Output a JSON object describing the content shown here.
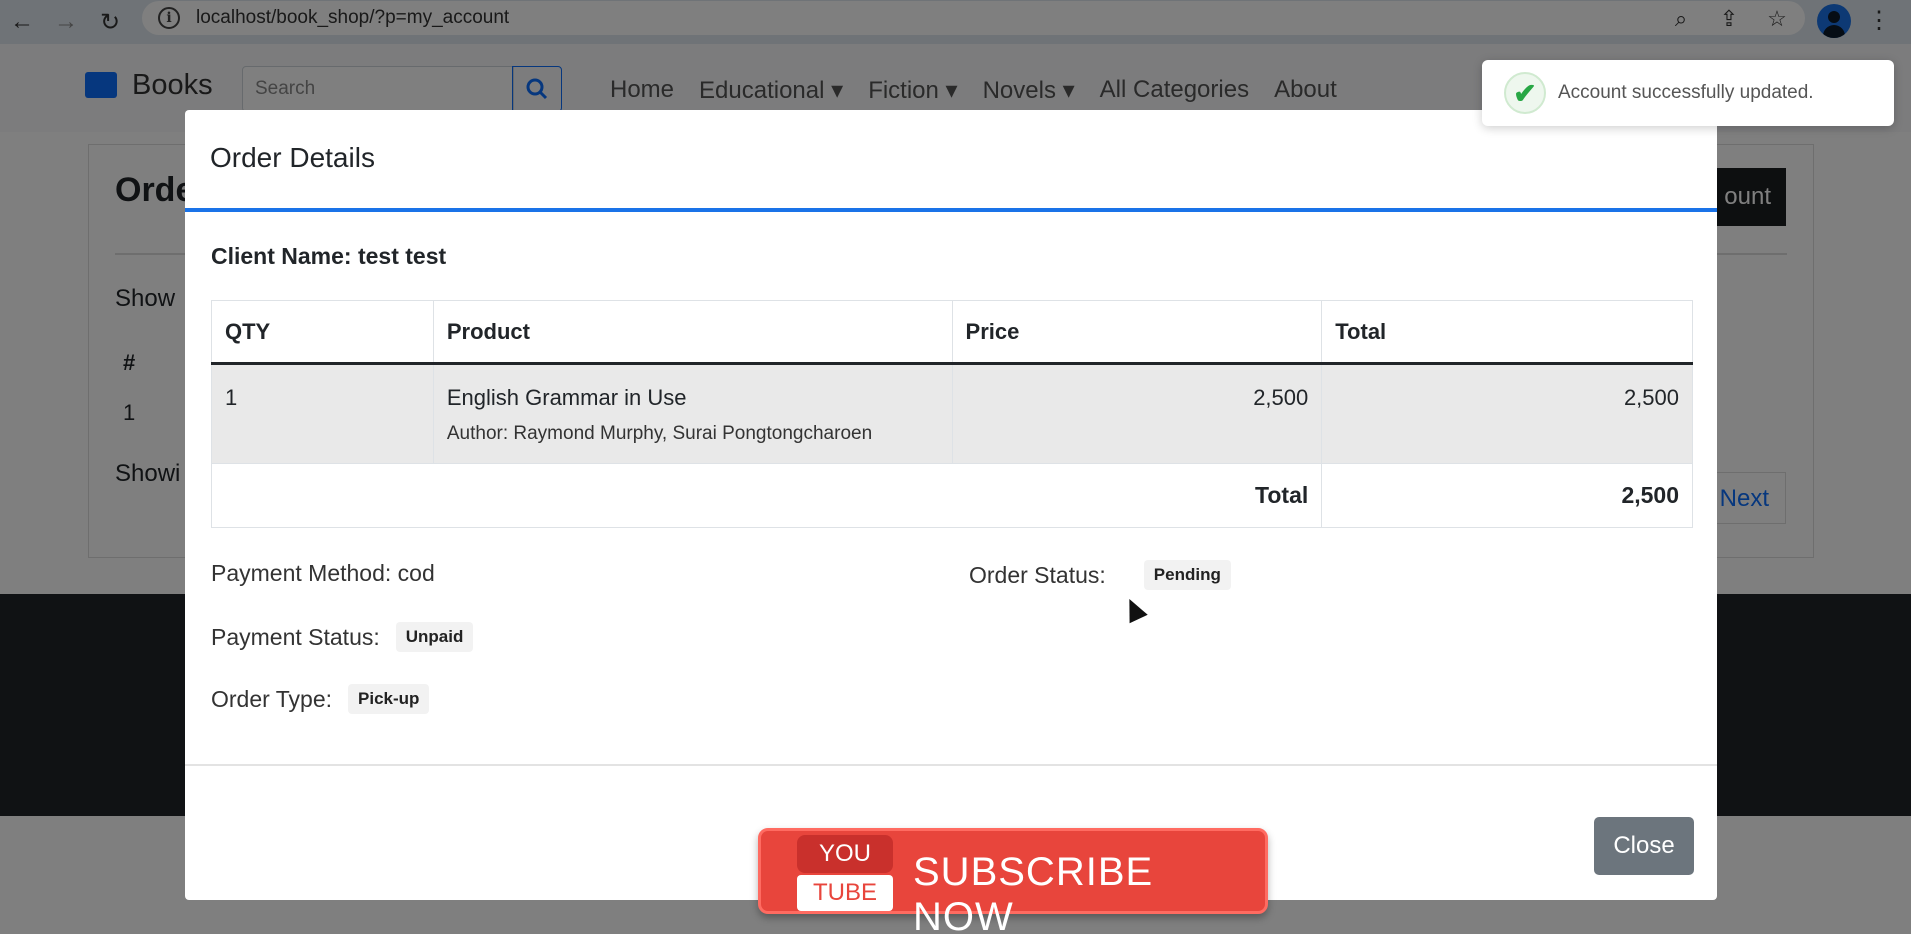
{
  "browser": {
    "url": "localhost/book_shop/?p=my_account"
  },
  "navbar": {
    "brand": "Books",
    "search_placeholder": "Search",
    "links": [
      "Home",
      "Educational",
      "Fiction",
      "Novels",
      "All Categories",
      "About"
    ]
  },
  "background_page": {
    "card_title": "Orde",
    "show_label": "Show",
    "col_hash": "#",
    "row_number": "1",
    "showing_label": "Showi",
    "account_button": "ount",
    "next_button": "Next"
  },
  "modal": {
    "title": "Order Details",
    "client_label": "Client Name:",
    "client_name": "test test",
    "table": {
      "headers": [
        "QTY",
        "Product",
        "Price",
        "Total"
      ],
      "rows": [
        {
          "qty": "1",
          "product": "English Grammar in Use",
          "author": "Author: Raymond Murphy, Surai Pongtongcharoen",
          "price": "2,500",
          "total": "2,500"
        }
      ],
      "total_label": "Total",
      "total_value": "2,500"
    },
    "payment_method_label": "Payment Method:",
    "payment_method": "cod",
    "payment_status_label": "Payment Status:",
    "payment_status": "Unpaid",
    "order_type_label": "Order Type:",
    "order_type": "Pick-up",
    "order_status_label": "Order Status:",
    "order_status": "Pending",
    "close_label": "Close"
  },
  "toast": {
    "message": "Account successfully updated."
  },
  "overlay": {
    "you": "YOU",
    "tube": "TUBE",
    "subscribe": "SUBSCRIBE NOW"
  },
  "colors": {
    "accent": "#1a73e8",
    "success": "#28a745",
    "subscribe_red": "#e8453c"
  }
}
